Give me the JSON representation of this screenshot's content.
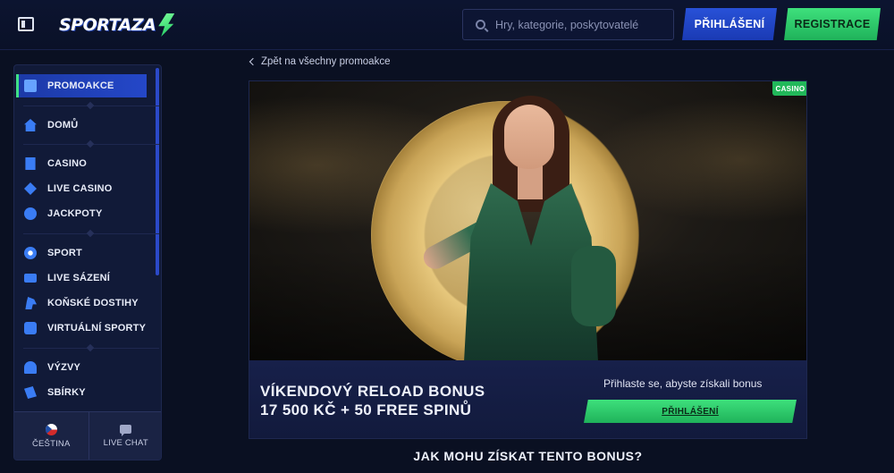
{
  "header": {
    "logo_text": "SPORTAZA",
    "search_placeholder": "Hry, kategorie, poskytovatelé",
    "login_label": "PŘIHLÁŠENÍ",
    "register_label": "REGISTRACE"
  },
  "sidebar": {
    "items": [
      {
        "label": "PROMOAKCE",
        "icon": "gift-icon",
        "active": true
      },
      {
        "label": "DOMŮ",
        "icon": "home-icon"
      },
      {
        "label": "CASINO",
        "icon": "slot-machine-icon"
      },
      {
        "label": "LIVE CASINO",
        "icon": "card-icon"
      },
      {
        "label": "JACKPOTY",
        "icon": "clover-icon"
      },
      {
        "label": "SPORT",
        "icon": "soccer-ball-icon"
      },
      {
        "label": "LIVE SÁZENÍ",
        "icon": "live-icon"
      },
      {
        "label": "KOŇSKÉ DOSTIHY",
        "icon": "horse-icon"
      },
      {
        "label": "VIRTUÁLNÍ SPORTY",
        "icon": "virtual-sports-icon"
      },
      {
        "label": "VÝZVY",
        "icon": "medal-icon"
      },
      {
        "label": "SBÍRKY",
        "icon": "cards-collection-icon"
      }
    ],
    "footer": {
      "language_label": "ČEŠTINA",
      "chat_label": "LIVE CHAT"
    }
  },
  "main": {
    "back_link": "Zpět na všechny promoakce",
    "promo": {
      "badge": "CASINO",
      "title_line1": "VÍKENDOVÝ RELOAD BONUS",
      "title_line2": "17 500 KČ + 50 FREE SPINŮ",
      "login_hint": "Přihlaste se, abyste získali bonus",
      "login_button": "PŘIHLÁŠENÍ"
    },
    "section_heading": "JAK MOHU ZÍSKAT TENTO BONUS?"
  },
  "colors": {
    "background": "#0a1022",
    "accent_blue": "#2447c8",
    "accent_green": "#2fce6e"
  }
}
